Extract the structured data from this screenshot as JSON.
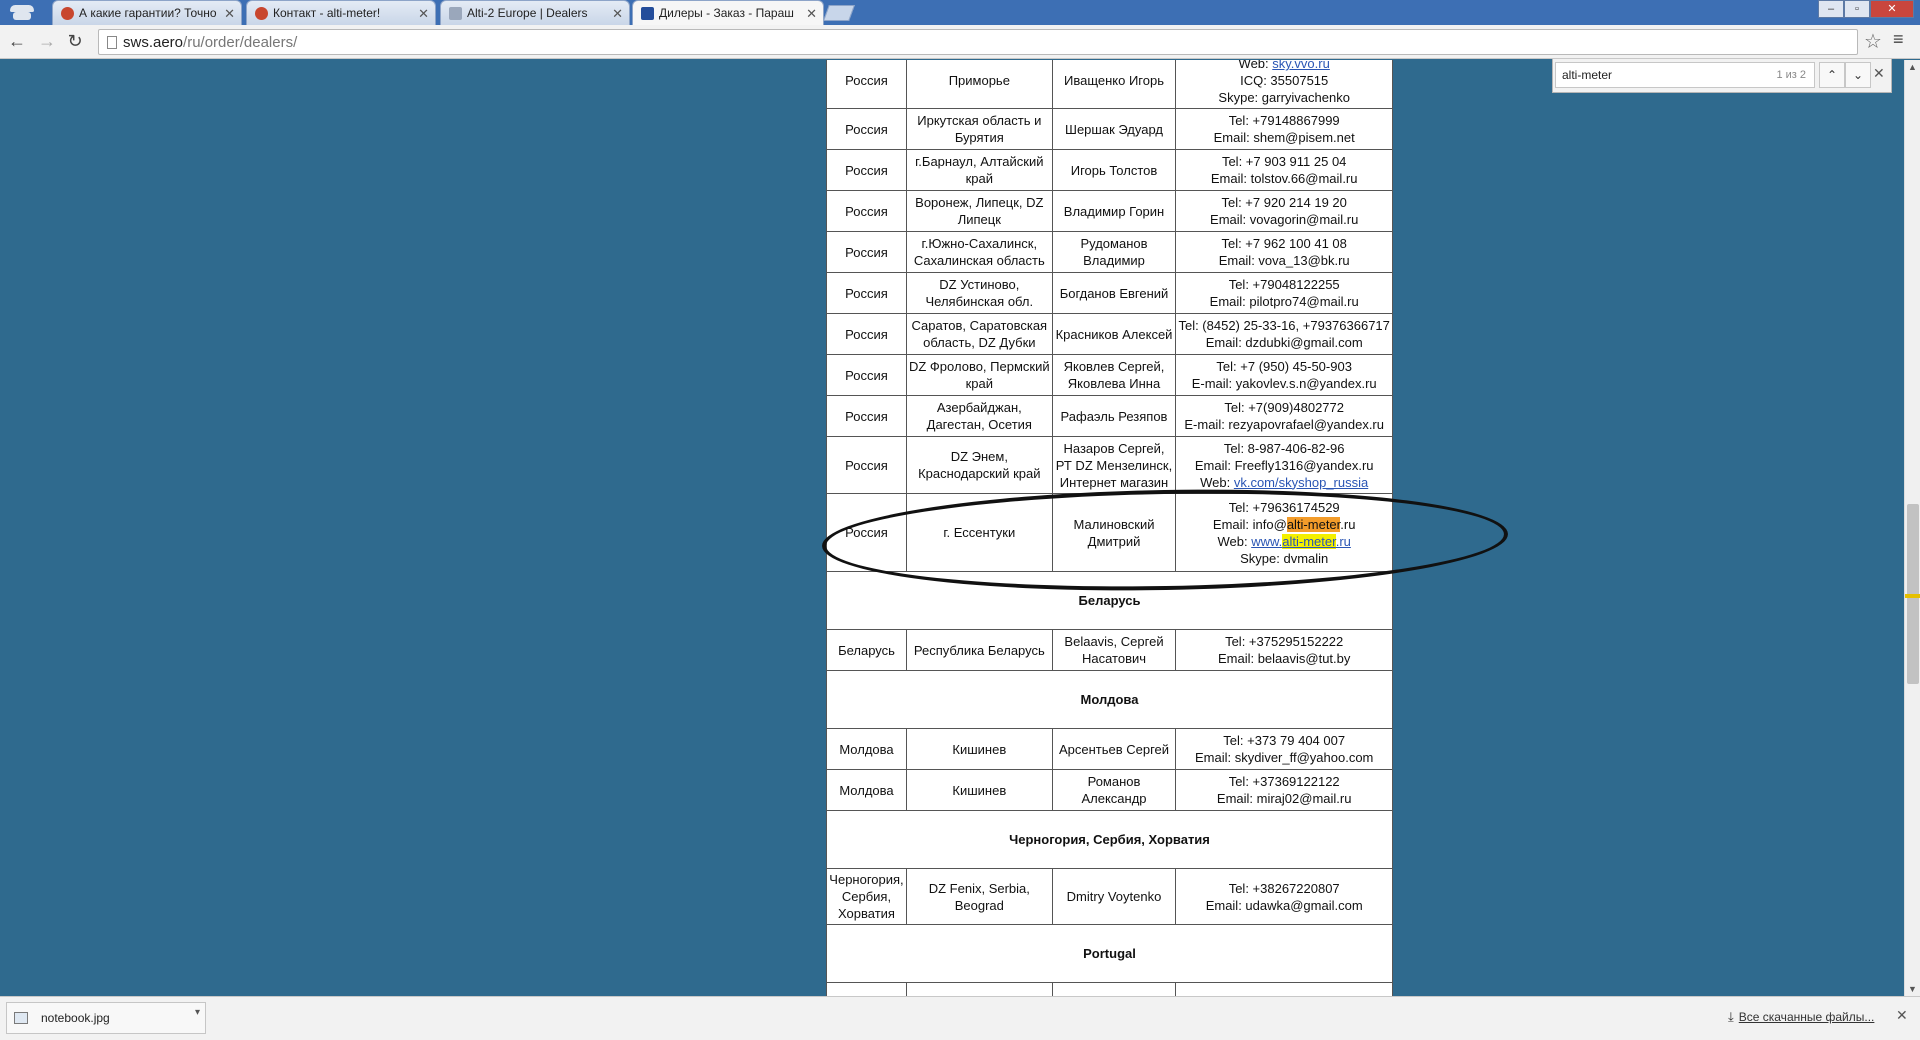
{
  "tabs": [
    {
      "title": "А какие гарантии? Точно",
      "icon": "altimeter-icon"
    },
    {
      "title": "Контакт - alti-meter!",
      "icon": "altimeter-icon"
    },
    {
      "title": "Alti-2 Europe | Dealers",
      "icon": "blank-page-icon"
    },
    {
      "title": "Дилеры - Заказ - Параш",
      "icon": "sws-logo-icon",
      "active": true
    }
  ],
  "address_bar": {
    "domain": "sws.aero",
    "path": "/ru/order/dealers/"
  },
  "find_bar": {
    "query": "alti-meter",
    "count": "1 из 2"
  },
  "table": {
    "top_rows": [
      {
        "country": "Россия",
        "region": "Приморье",
        "name": "Иващенко Игорь",
        "contacts": [
          {
            "label": "Web: ",
            "link": "sky.vvo.ru"
          },
          {
            "text": "ICQ: 35507515"
          },
          {
            "text": "Skype: garryivachenko"
          }
        ]
      },
      {
        "country": "Россия",
        "region": "Иркутская область и Бурятия",
        "name": "Шершак Эдуард",
        "contacts": [
          {
            "text": "Tel: +79148867999"
          },
          {
            "text": "Email: shem@pisem.net"
          }
        ]
      },
      {
        "country": "Россия",
        "region": "г.Барнаул, Алтайский край",
        "name": "Игорь Толстов",
        "contacts": [
          {
            "text": "Tel: +7 903 911 25 04"
          },
          {
            "text": "Email: tolstov.66@mail.ru"
          }
        ]
      },
      {
        "country": "Россия",
        "region": "Воронеж, Липецк, DZ Липецк",
        "name": "Владимир Горин",
        "contacts": [
          {
            "text": "Tel: +7 920 214 19 20"
          },
          {
            "text": "Email: vovagorin@mail.ru"
          }
        ]
      },
      {
        "country": "Россия",
        "region": "г.Южно-Сахалинск, Сахалинская область",
        "name": "Рудоманов Владимир",
        "contacts": [
          {
            "text": "Tel: +7 962 100 41 08"
          },
          {
            "text": "Email: vova_13@bk.ru"
          }
        ]
      },
      {
        "country": "Россия",
        "region": "DZ Устиново, Челябинская обл.",
        "name": "Богданов Евгений",
        "contacts": [
          {
            "text": "Tel: +79048122255"
          },
          {
            "text": "Email: pilotpro74@mail.ru"
          }
        ]
      },
      {
        "country": "Россия",
        "region": "Саратов, Саратовская область, DZ Дубки",
        "name": "Красников Алексей",
        "contacts": [
          {
            "text": "Tel: (8452) 25-33-16, +79376366717"
          },
          {
            "text": "Email: dzdubki@gmail.com"
          }
        ]
      },
      {
        "country": "Россия",
        "region": "DZ Фролово, Пермский край",
        "name": "Яковлев Сергей, Яковлева Инна",
        "contacts": [
          {
            "text": "Tel: +7 (950) 45-50-903"
          },
          {
            "text": "E-mail: yakovlev.s.n@yandex.ru"
          }
        ]
      },
      {
        "country": "Россия",
        "region": "Азербайджан, Дагестан, Осетия",
        "name": "Рафаэль Резяпов",
        "contacts": [
          {
            "text": "Tel: +7(909)4802772"
          },
          {
            "text": "E-mail: rezyapovrafael@yandex.ru"
          }
        ]
      },
      {
        "country": "Россия",
        "region": "DZ Энем, Краснодарский край",
        "name": "Назаров Сергей, РТ DZ Мензелинск, Интернет магазин",
        "contacts": [
          {
            "text": "Tel:  8-987-406-82-96"
          },
          {
            "text": "Email: Freefly1316@yandex.ru"
          },
          {
            "label": "Web: ",
            "link": "vk.com/skyshop_russia"
          }
        ]
      }
    ],
    "highlighted_row": {
      "country": "Россия",
      "region": "г. Ессентуки",
      "name": "Малиновский Дмитрий",
      "tel": "Tel: +79636174529",
      "email_prefix": "Email: info@",
      "email_match": "alti-meter",
      "email_suffix": ".ru",
      "web_label": "Web: ",
      "web_prefix": "www.",
      "web_match": "alti-meter",
      "web_suffix": ".ru",
      "skype": "Skype: dvmalin"
    },
    "sections": [
      {
        "title": "Беларусь",
        "rows": [
          {
            "country": "Беларусь",
            "region": "Республика Беларусь",
            "name": "Belaavis, Сергей Насатович",
            "contacts": [
              {
                "text": "Tel: +375295152222"
              },
              {
                "text": "Email: belaavis@tut.by"
              }
            ]
          }
        ]
      },
      {
        "title": "Молдова",
        "rows": [
          {
            "country": "Молдова",
            "region": "Кишинев",
            "name": "Арсентьев Сергей",
            "contacts": [
              {
                "text": "Tel: +373 79 404 007"
              },
              {
                "text": "Email: skydiver_ff@yahoo.com"
              }
            ]
          },
          {
            "country": "Молдова",
            "region": "Кишинев",
            "name": "Романов Александр",
            "contacts": [
              {
                "text": "Tel: +37369122122"
              },
              {
                "text": "Email: miraj02@mail.ru"
              }
            ]
          }
        ]
      },
      {
        "title": "Черногория, Сербия, Хорватия",
        "rows": [
          {
            "country": "Черногория, Сербия, Хорватия",
            "region": "DZ Fenix, Serbia, Beograd",
            "name": "Dmitry Voytenko",
            "contacts": [
              {
                "text": "Tel: +38267220807"
              },
              {
                "text": "Email: udawka@gmail.com"
              }
            ]
          }
        ]
      },
      {
        "title": "Portugal",
        "rows": []
      }
    ]
  },
  "download_bar": {
    "file_name": "notebook.jpg",
    "show_all": "Все скачанные файлы..."
  },
  "colors": {
    "page_background": "#2f6a8e",
    "find_highlight": "#f4f000",
    "find_current": "#f39c2a",
    "tabstrip": "#3d6fb4"
  }
}
